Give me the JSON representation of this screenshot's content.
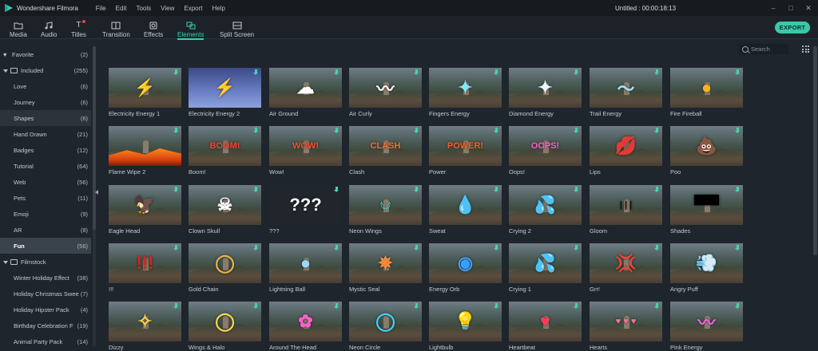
{
  "app": {
    "name": "Wondershare Filmora",
    "window_title": "Untitled : 00:00:18:13",
    "menu": [
      "File",
      "Edit",
      "Tools",
      "View",
      "Export",
      "Help"
    ]
  },
  "tabs": [
    {
      "label": "Media",
      "icon": "folder-icon",
      "dot": false
    },
    {
      "label": "Audio",
      "icon": "music-note-icon",
      "dot": false
    },
    {
      "label": "Titles",
      "icon": "text-t-icon",
      "dot": true
    },
    {
      "label": "Transition",
      "icon": "transition-icon",
      "dot": true
    },
    {
      "label": "Effects",
      "icon": "effects-icon",
      "dot": true
    },
    {
      "label": "Elements",
      "icon": "elements-icon",
      "dot": false,
      "active": true
    },
    {
      "label": "Split Screen",
      "icon": "split-screen-icon",
      "dot": false
    }
  ],
  "export_label": "EXPORT",
  "search": {
    "placeholder": "Search"
  },
  "sidebar": {
    "items": [
      {
        "label": "Favorite",
        "count": "(2)",
        "kind": "head-fav"
      },
      {
        "label": "Included",
        "count": "(255)",
        "kind": "head-folder"
      },
      {
        "label": "Love",
        "count": "(6)",
        "kind": "sub"
      },
      {
        "label": "Journey",
        "count": "(6)",
        "kind": "sub"
      },
      {
        "label": "Shapes",
        "count": "(6)",
        "kind": "sub",
        "shaded": true
      },
      {
        "label": "Hand Drawn",
        "count": "(21)",
        "kind": "sub"
      },
      {
        "label": "Badges",
        "count": "(12)",
        "kind": "sub"
      },
      {
        "label": "Tutorial",
        "count": "(64)",
        "kind": "sub"
      },
      {
        "label": "Web",
        "count": "(56)",
        "kind": "sub"
      },
      {
        "label": "Pets",
        "count": "(11)",
        "kind": "sub"
      },
      {
        "label": "Emoji",
        "count": "(9)",
        "kind": "sub"
      },
      {
        "label": "AR",
        "count": "(8)",
        "kind": "sub"
      },
      {
        "label": "Fun",
        "count": "(56)",
        "kind": "sub",
        "selected": true
      },
      {
        "label": "Filmstock",
        "count": "",
        "kind": "head-folder"
      },
      {
        "label": "Winter Holiday Effect",
        "count": "(38)",
        "kind": "sub"
      },
      {
        "label": "Holiday Christmas Swee",
        "count": "(7)",
        "kind": "sub"
      },
      {
        "label": "Holiday Hipster Pack",
        "count": "(4)",
        "kind": "sub"
      },
      {
        "label": "Birthday Celebration F",
        "count": "(19)",
        "kind": "sub"
      },
      {
        "label": "Animal Party Pack",
        "count": "(14)",
        "kind": "sub"
      }
    ]
  },
  "elements": [
    {
      "label": "Electricity Energy 1",
      "overlay": "⚡",
      "color": "#cfe3ff",
      "style": ""
    },
    {
      "label": "Electricity Energy 2",
      "overlay": "⚡",
      "color": "#ffffff",
      "style": "sky"
    },
    {
      "label": "Air Ground",
      "overlay": "☁",
      "color": "#ffffff",
      "style": ""
    },
    {
      "label": "Air Curly",
      "overlay": "〰",
      "color": "#ffffff",
      "style": ""
    },
    {
      "label": "Fingers Energy",
      "overlay": "✦",
      "color": "#7fe8ff",
      "style": ""
    },
    {
      "label": "Diamond Energy",
      "overlay": "✦",
      "color": "#e6f7ff",
      "style": ""
    },
    {
      "label": "Trail Energy",
      "overlay": "〜",
      "color": "#9fe3ff",
      "style": ""
    },
    {
      "label": "Fire Fireball",
      "overlay": "●",
      "color": "#ffb11f",
      "style": ""
    },
    {
      "label": "Flame Wipe 2",
      "overlay": "",
      "color": "#ff7a12",
      "style": "fire"
    },
    {
      "label": "Boom!",
      "overlay": "BOOM!",
      "color": "#ff3d2e",
      "style": ""
    },
    {
      "label": "Wow!",
      "overlay": "WOW!",
      "color": "#ff4a2a",
      "style": ""
    },
    {
      "label": "Clash",
      "overlay": "CLASH",
      "color": "#ff6a2a",
      "style": ""
    },
    {
      "label": "Power",
      "overlay": "POWER!",
      "color": "#ff5a1f",
      "style": ""
    },
    {
      "label": "Oops!",
      "overlay": "OOPS!",
      "color": "#ff5fbf",
      "style": ""
    },
    {
      "label": "Lips",
      "overlay": "💋",
      "color": "#ff3fa8",
      "style": ""
    },
    {
      "label": "Poo",
      "overlay": "💩",
      "color": "#8a5a2e",
      "style": ""
    },
    {
      "label": "Eagle Head",
      "overlay": "🦅",
      "color": "#ffffff",
      "style": ""
    },
    {
      "label": "Clown Skull",
      "overlay": "☠",
      "color": "#ffffff",
      "style": ""
    },
    {
      "label": "???",
      "overlay": "???",
      "color": "#ffffff",
      "style": "dark"
    },
    {
      "label": "Neon Wings",
      "overlay": "𓆩𓆪",
      "color": "#3de0e0",
      "style": ""
    },
    {
      "label": "Sweat",
      "overlay": "💧",
      "color": "#8fd6ff",
      "style": ""
    },
    {
      "label": "Crying 2",
      "overlay": "💦",
      "color": "#6ad0ff",
      "style": ""
    },
    {
      "label": "Gloom",
      "overlay": "| | |",
      "color": "#111111",
      "style": ""
    },
    {
      "label": "Shades",
      "overlay": "▀▀",
      "color": "#000000",
      "style": ""
    },
    {
      "label": "!!!",
      "overlay": "!!!",
      "color": "#e0201a",
      "style": ""
    },
    {
      "label": "Gold Chain",
      "overlay": "◯",
      "color": "#e8b44a",
      "style": ""
    },
    {
      "label": "Lightning Ball",
      "overlay": "●",
      "color": "#9ad8ff",
      "style": ""
    },
    {
      "label": "Mystic Seal",
      "overlay": "✵",
      "color": "#ff8c3a",
      "style": ""
    },
    {
      "label": "Energy Orb",
      "overlay": "◉",
      "color": "#3aa0ff",
      "style": ""
    },
    {
      "label": "Crying 1",
      "overlay": "💦",
      "color": "#5cc8ff",
      "style": ""
    },
    {
      "label": "Grr!",
      "overlay": "💢",
      "color": "#ffffff",
      "style": ""
    },
    {
      "label": "Angry Puff",
      "overlay": "💨",
      "color": "#ffffff",
      "style": ""
    },
    {
      "label": "Dizzy",
      "overlay": "✧",
      "color": "#ffd24a",
      "style": ""
    },
    {
      "label": "Wings & Halo",
      "overlay": "◯",
      "color": "#ffd84a",
      "style": ""
    },
    {
      "label": "Around The Head",
      "overlay": "✿",
      "color": "#ff5fd0",
      "style": ""
    },
    {
      "label": "Neon Circle",
      "overlay": "◯",
      "color": "#3ad6ff",
      "style": ""
    },
    {
      "label": "Lightbulb",
      "overlay": "💡",
      "color": "#ffe04a",
      "style": ""
    },
    {
      "label": "Heartbeat",
      "overlay": "♥",
      "color": "#ff3a5a",
      "style": ""
    },
    {
      "label": "Hearts",
      "overlay": "♥ ♥ ♥",
      "color": "#ff6f9a",
      "style": ""
    },
    {
      "label": "Pink Energy",
      "overlay": "〰",
      "color": "#ff5fe0",
      "style": ""
    }
  ]
}
